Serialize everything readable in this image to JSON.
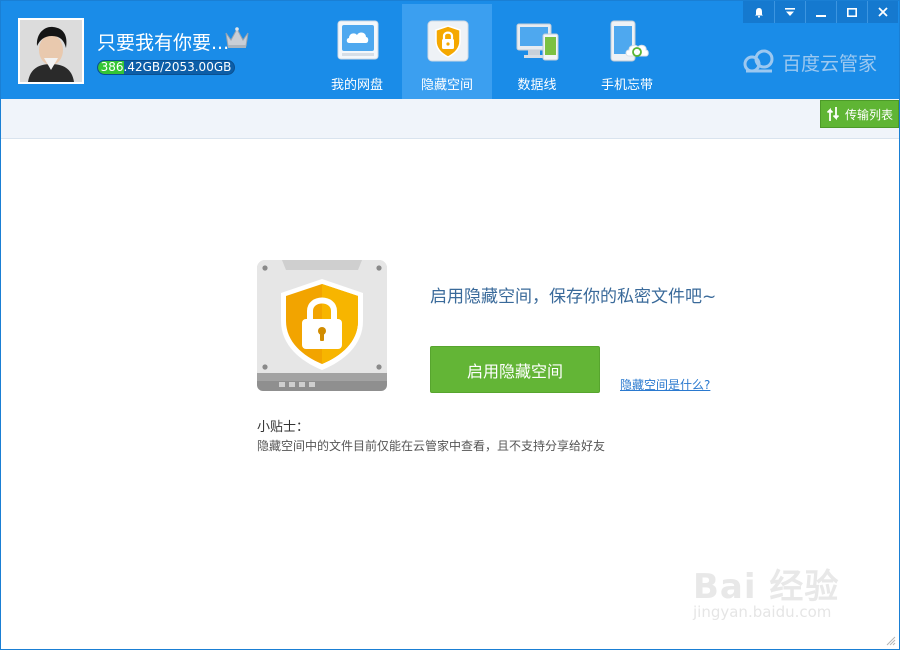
{
  "user": {
    "name": "只要我有你要...",
    "quota_text": "386.42GB/2053.00GB",
    "quota_fraction": 0.188
  },
  "nav": {
    "items": [
      {
        "label": "我的网盘",
        "icon": "cloud-disk-icon"
      },
      {
        "label": "隐藏空间",
        "icon": "shield-lock-icon",
        "active": true
      },
      {
        "label": "数据线",
        "icon": "monitor-phone-icon"
      },
      {
        "label": "手机忘带",
        "icon": "phone-sync-icon"
      }
    ]
  },
  "brand": {
    "name": "百度云管家"
  },
  "toolbar": {
    "transfer_label": "传输列表"
  },
  "main": {
    "headline": "启用隐藏空间，保存你的私密文件吧~",
    "enable_label": "启用隐藏空间",
    "whatis_link": "隐藏空间是什么?",
    "tips_title": "小贴士：",
    "tips_text": "隐藏空间中的文件目前仅能在云管家中查看，且不支持分享给好友"
  },
  "watermark": {
    "text": "Bai 经验",
    "url": "jingyan.baidu.com"
  },
  "colors": {
    "header": "#1a8ce8",
    "nav_active": "#3b9ff0",
    "primary_green": "#63b536",
    "link": "#2a79cf"
  }
}
